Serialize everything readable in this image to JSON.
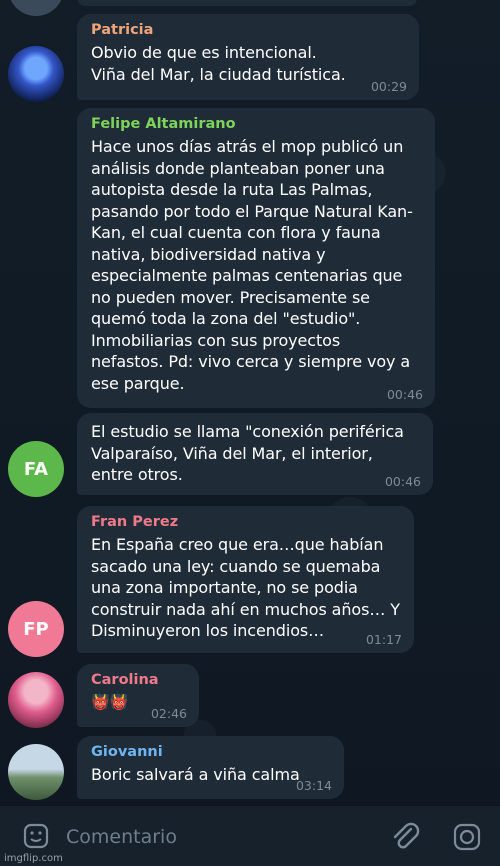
{
  "messages": [
    {
      "sender": "Patricia",
      "sender_color": "#f0a47a",
      "text": "Obvio de que es intencional.\nViña del Mar, la ciudad turística.",
      "time": "00:29"
    },
    {
      "sender": "Felipe Altamirano",
      "sender_color": "#7ed35b",
      "text": "Hace unos días atrás el mop publicó un análisis donde planteaban poner una autopista desde la ruta Las Palmas, pasando por todo el Parque Natural Kan-Kan, el cual cuenta con flora y fauna nativa, biodiversidad nativa y especialmente palmas centenarias que no pueden mover. Precisamente se quemó toda la zona del \"estudio\". Inmobiliarias con sus proyectos nefastos. Pd: vivo cerca y siempre voy a ese parque.",
      "time": "00:46"
    },
    {
      "sender": "",
      "text": "El estudio se llama \"conexión periférica Valparaíso, Viña del Mar, el interior, entre otros.",
      "time": "00:46",
      "avatar_initials": "FA",
      "avatar_color": "#5cb84a"
    },
    {
      "sender": "Fran Perez",
      "sender_color": "#f07a8a",
      "text": "En España creo que era…que habían sacado una ley: cuando se quemaba una zona importante, no se podia construir nada ahí en muchos años… Y Disminuyeron los incendios…",
      "time": "01:17",
      "avatar_initials": "FP",
      "avatar_color": "#f07a95"
    },
    {
      "sender": "Carolina",
      "sender_color": "#f07a8a",
      "text": "👹👹",
      "time": "02:46"
    },
    {
      "sender": "Giovanni",
      "sender_color": "#6fb5f2",
      "text": "Boric salvará a viña calma",
      "time": "03:14"
    }
  ],
  "input": {
    "placeholder": "Comentario"
  },
  "icons": {
    "sticker": "sticker-icon",
    "attach": "paperclip-icon",
    "camera": "camera-icon"
  },
  "watermark": "imgflip.com"
}
